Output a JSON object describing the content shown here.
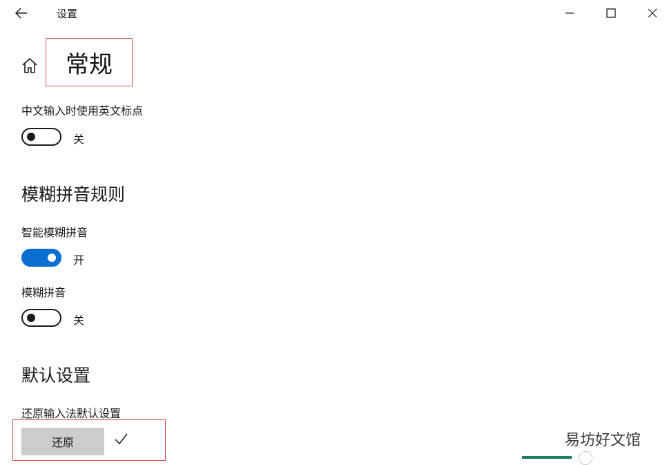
{
  "window": {
    "title": "设置"
  },
  "page": {
    "title": "常规"
  },
  "settings": {
    "english_punct": {
      "label": "中文输入时使用英文标点",
      "enabled": false,
      "state": "关"
    },
    "fuzzy_heading": "模糊拼音规则",
    "smart_fuzzy": {
      "label": "智能模糊拼音",
      "enabled": true,
      "state": "开"
    },
    "fuzzy": {
      "label": "模糊拼音",
      "enabled": false,
      "state": "关"
    },
    "default_heading": "默认设置",
    "restore_label": "还原输入法默认设置",
    "restore_button": "还原"
  },
  "watermark": "易坊好文馆",
  "colors": {
    "accent": "#0a6fd1",
    "highlight_border": "#d9534f",
    "button_gray": "#cccccc"
  },
  "icons": [
    "back-arrow-icon",
    "minimize-icon",
    "maximize-icon",
    "close-icon",
    "home-icon",
    "checkmark-icon"
  ]
}
